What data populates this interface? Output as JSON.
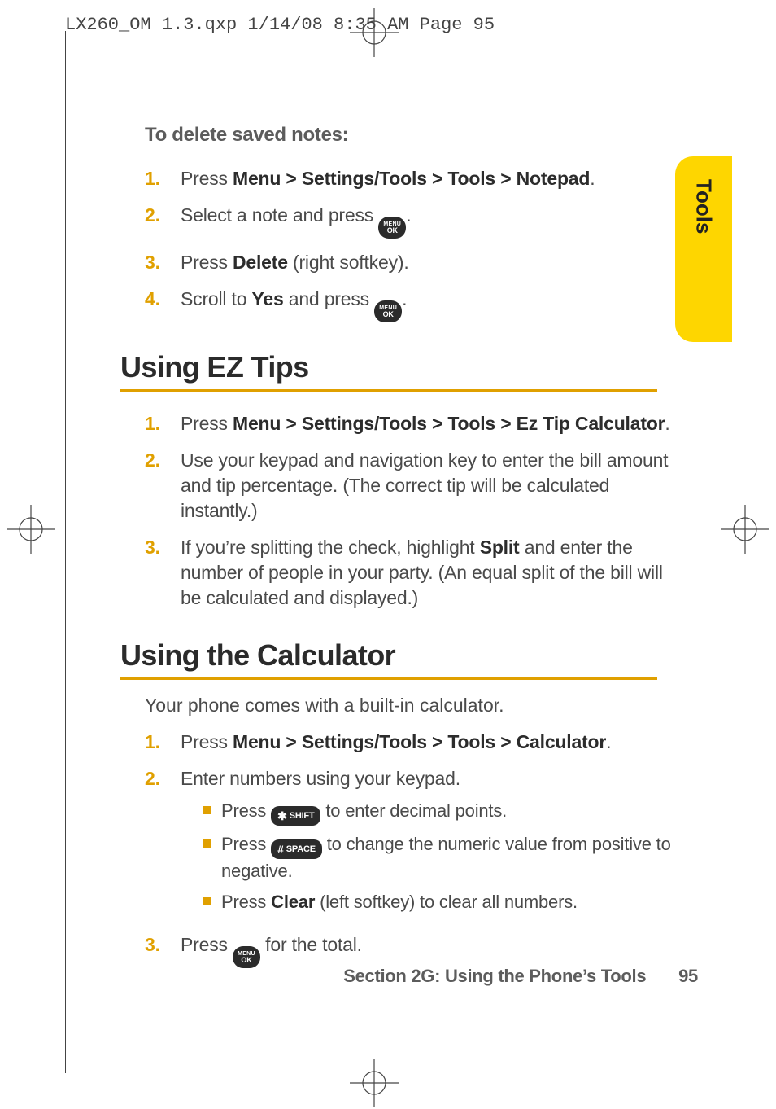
{
  "slug": "LX260_OM 1.3.qxp  1/14/08  8:35 AM  Page 95",
  "tab_label": "Tools",
  "delete_notes": {
    "heading": "To delete saved notes:",
    "steps": [
      {
        "n": "1.",
        "pre": "Press ",
        "bold": "Menu > Settings/Tools > Tools > Notepad",
        "post": "."
      },
      {
        "n": "2.",
        "pre": "Select a note and press ",
        "icon": "ok",
        "post": "."
      },
      {
        "n": "3.",
        "pre": "Press ",
        "bold": "Delete",
        "post": " (right softkey)."
      },
      {
        "n": "4.",
        "pre": "Scroll to ",
        "bold": "Yes",
        "mid": " and press ",
        "icon": "ok",
        "post": "."
      }
    ]
  },
  "ez": {
    "heading": "Using EZ Tips",
    "steps": [
      {
        "n": "1.",
        "pre": "Press ",
        "bold": "Menu > Settings/Tools > Tools > Ez Tip Calculator",
        "post": "."
      },
      {
        "n": "2.",
        "text": "Use your keypad and navigation key to enter the bill amount and tip percentage. (The correct tip will be calculated instantly.)"
      },
      {
        "n": "3.",
        "pre": "If you’re splitting the check, highlight ",
        "bold": "Split",
        "post": " and enter the number of people in your party. (An equal split of the bill will be calculated and displayed.)"
      }
    ]
  },
  "calc": {
    "heading": "Using the Calculator",
    "intro": "Your phone comes with a built-in calculator.",
    "steps": [
      {
        "n": "1.",
        "pre": "Press ",
        "bold": "Menu > Settings/Tools > Tools > Calculator",
        "post": "."
      },
      {
        "n": "2.",
        "text": "Enter numbers using your keypad.",
        "sub": [
          {
            "pre": "Press ",
            "key": "shift",
            "post": " to enter decimal points."
          },
          {
            "pre": "Press ",
            "key": "space",
            "post": " to change the numeric value from positive to negative."
          },
          {
            "pre": "Press ",
            "bold": "Clear",
            "post": " (left softkey) to clear all numbers."
          }
        ]
      },
      {
        "n": "3.",
        "pre": "Press ",
        "icon": "ok",
        "post": " for the total."
      }
    ]
  },
  "keys": {
    "shift": {
      "sym": "✱",
      "label": "SHIFT"
    },
    "space": {
      "sym": "#",
      "label": "SPACE"
    }
  },
  "footer": {
    "section": "Section 2G: Using the Phone’s Tools",
    "page": "95"
  }
}
